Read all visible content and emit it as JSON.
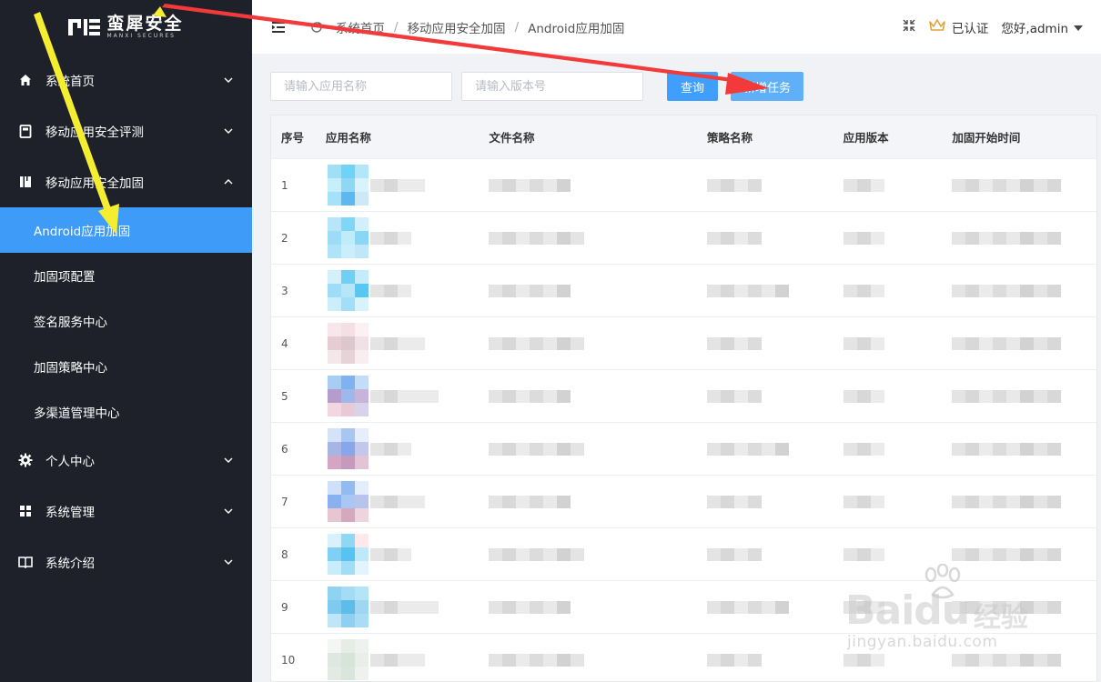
{
  "app": {
    "logo_cn": "蛮犀安全",
    "logo_en": "MANXI SECURES"
  },
  "sidebar": {
    "items": [
      {
        "label": "系统首页",
        "icon": "home-icon",
        "expanded": false
      },
      {
        "label": "移动应用安全评测",
        "icon": "document-icon",
        "expanded": false
      },
      {
        "label": "移动应用安全加固",
        "icon": "book-icon",
        "expanded": true,
        "children": [
          "Android应用加固",
          "加固项配置",
          "签名服务中心",
          "加固策略中心",
          "多渠道管理中心"
        ]
      },
      {
        "label": "个人中心",
        "icon": "gear-icon",
        "expanded": false
      },
      {
        "label": "系统管理",
        "icon": "grid-icon",
        "expanded": false
      },
      {
        "label": "系统介绍",
        "icon": "open-book-icon",
        "expanded": false
      }
    ],
    "active_child": "Android应用加固"
  },
  "header": {
    "breadcrumb": [
      "系统首页",
      "移动应用安全加固",
      "Android应用加固"
    ],
    "verified": "已认证",
    "user": "您好,admin"
  },
  "filters": {
    "app_name_placeholder": "请输入应用名称",
    "version_placeholder": "请输入版本号",
    "query_label": "查询",
    "new_task_label": "新增任务"
  },
  "table": {
    "columns": [
      "序号",
      "应用名称",
      "文件名称",
      "策略名称",
      "应用版本",
      "加固开始时间"
    ],
    "rows": [
      "1",
      "2",
      "3",
      "4",
      "5",
      "6",
      "7",
      "8",
      "9",
      "10"
    ]
  },
  "watermark": {
    "brand": "Baidu",
    "cn": "经验",
    "url": "jingyan.baidu.com"
  },
  "colors": {
    "sidebar_bg": "#1e2129",
    "active_bg": "#3e9bf8",
    "primary": "#409eff"
  }
}
